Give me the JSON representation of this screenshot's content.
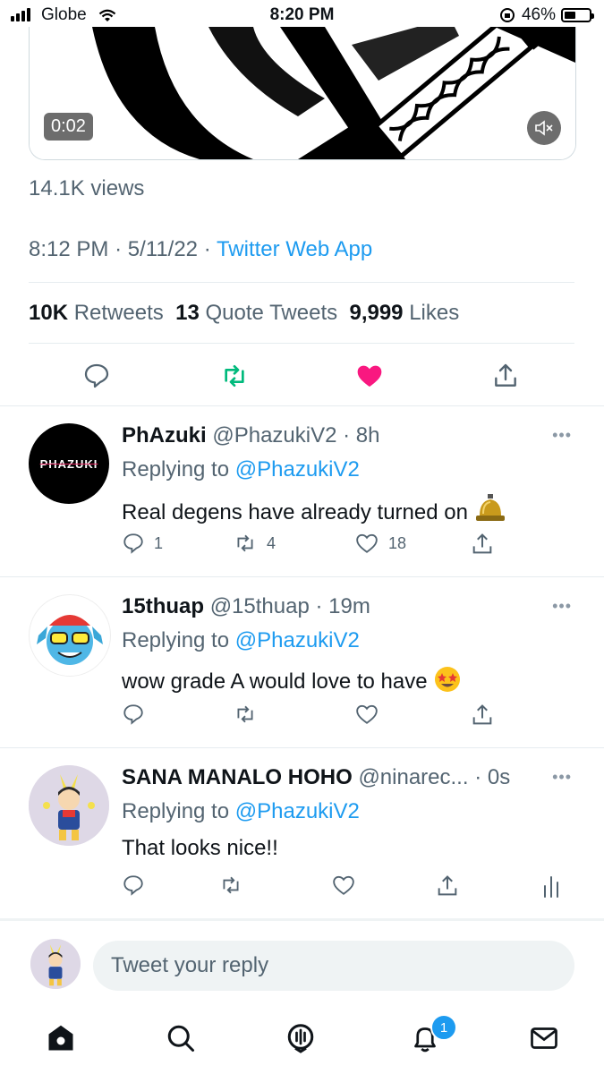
{
  "status_bar": {
    "carrier": "Globe",
    "time": "8:20 PM",
    "battery": "46%",
    "battery_level": 0.46
  },
  "media": {
    "duration": "0:02"
  },
  "tweet": {
    "views": "14.1K views",
    "time": "8:12 PM",
    "separator": "·",
    "date": "5/11/22",
    "source": "Twitter Web App",
    "retweets_count": "10K",
    "retweets_label": "Retweets",
    "quotes_count": "13",
    "quotes_label": "Quote Tweets",
    "likes_count": "9,999",
    "likes_label": "Likes"
  },
  "replies": [
    {
      "name": "PhAzuki",
      "handle": "@PhazukiV2",
      "time": "· 8h",
      "replying_prefix": "Replying to",
      "replying_to": "@PhazukiV2",
      "text": "Real degens have already turned on",
      "emoji": "bell-icon",
      "avatar_text": "PHAZUKI",
      "replies": "1",
      "retweets": "4",
      "likes": "18"
    },
    {
      "name": "15thuap",
      "handle": "@15thuap",
      "time": "· 19m",
      "replying_prefix": "Replying to",
      "replying_to": "@PhazukiV2",
      "text": "wow grade A would love to have",
      "emoji": "star-struck-emoji",
      "replies": "",
      "retweets": "",
      "likes": ""
    },
    {
      "name": "SANA MANALO HOHO",
      "handle": "@ninarec...",
      "time": "· 0s",
      "replying_prefix": "Replying to",
      "replying_to": "@PhazukiV2",
      "text": "That looks nice!!",
      "replies": "",
      "retweets": "",
      "likes": ""
    }
  ],
  "compose": {
    "placeholder": "Tweet your reply"
  },
  "tabbar": {
    "notifications_badge": "1"
  },
  "colors": {
    "accent": "#1d9bf0",
    "like": "#f91880",
    "retweet": "#00ba7c",
    "muted": "#536471"
  }
}
